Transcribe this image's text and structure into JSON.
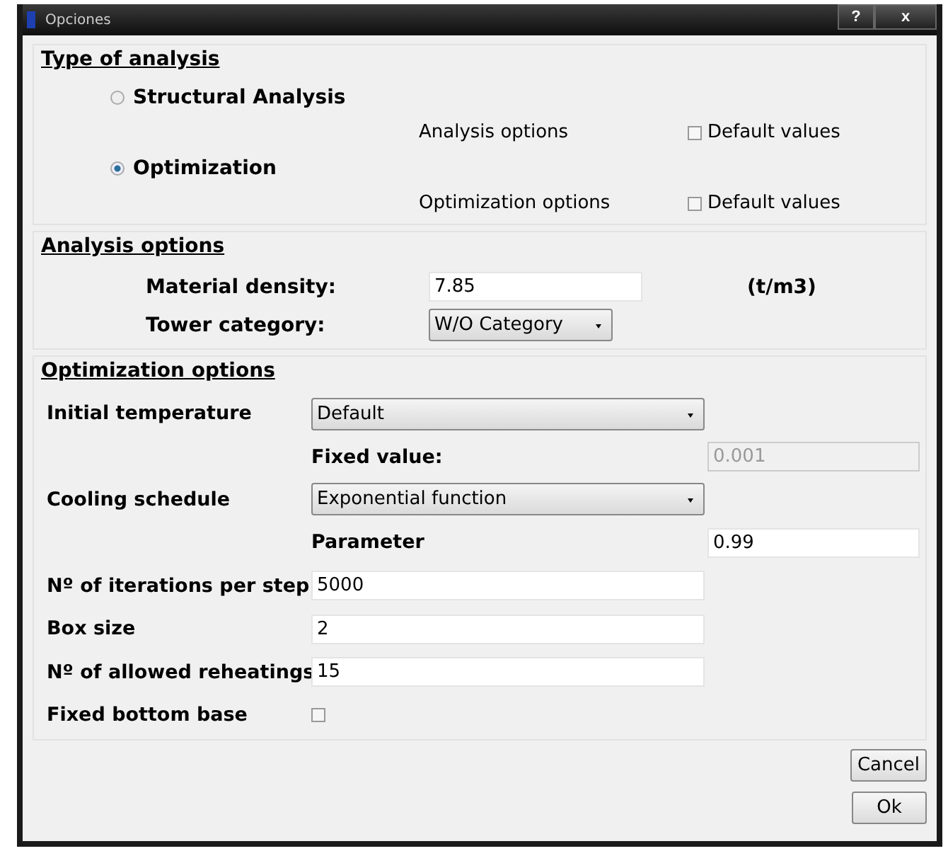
{
  "window": {
    "title": "Opciones",
    "help_button": "?",
    "close_button": "x"
  },
  "type_of_analysis": {
    "title": "Type of analysis",
    "options": [
      {
        "label": "Structural Analysis",
        "selected": false,
        "options_label": "Analysis options",
        "default_values": {
          "label": "Default values",
          "checked": false
        }
      },
      {
        "label": "Optimization",
        "selected": true,
        "options_label": "Optimization options",
        "default_values": {
          "label": "Default values",
          "checked": false
        }
      }
    ]
  },
  "analysis_options": {
    "title": "Analysis options",
    "density_label": "Material density:",
    "density_value": "7.85",
    "density_unit": "(t/m3)",
    "category_label": "Tower category:",
    "category_value": "W/O Category"
  },
  "optimization_options": {
    "title": "Optimization options",
    "rows": [
      {
        "kind": "select",
        "label": "Initial temperature",
        "value": "Default"
      },
      {
        "kind": "sub",
        "label": "Fixed value:",
        "value": "0.001",
        "disabled": true
      },
      {
        "kind": "select",
        "label": "Cooling schedule",
        "value": "Exponential function"
      },
      {
        "kind": "sub",
        "label": "Parameter",
        "value": "0.99",
        "disabled": false
      },
      {
        "kind": "input",
        "label": "Nº of iterations per step",
        "value": "5000"
      },
      {
        "kind": "input",
        "label": "Box size",
        "value": "2"
      },
      {
        "kind": "input",
        "label": "Nº of allowed reheatings",
        "value": "15"
      },
      {
        "kind": "check",
        "label": "Fixed bottom base",
        "checked": false
      }
    ]
  },
  "buttons": [
    "Cancel",
    "Ok"
  ]
}
